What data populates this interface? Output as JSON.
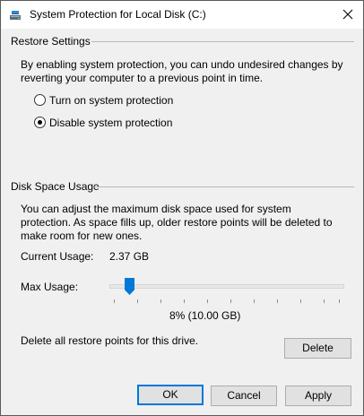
{
  "window": {
    "title": "System Protection for Local Disk (C:)",
    "icons": {
      "app": "system-protection-icon",
      "close": "close-icon"
    }
  },
  "restore_settings": {
    "header": "Restore Settings",
    "description": "By enabling system protection, you can undo undesired changes by reverting your computer to a previous point in time.",
    "options": [
      {
        "label": "Turn on system protection",
        "selected": false
      },
      {
        "label": "Disable system protection",
        "selected": true
      }
    ]
  },
  "disk_space": {
    "header": "Disk Space Usage",
    "description": "You can adjust the maximum disk space used for system protection. As space fills up, older restore points will be deleted to make room for new ones.",
    "current_usage_label": "Current Usage:",
    "current_usage_value": "2.37 GB",
    "max_usage_label": "Max Usage:",
    "max_usage_percent": 8,
    "max_usage_display": "8% (10.00 GB)",
    "delete_text": "Delete all restore points for this drive.",
    "delete_button": "Delete"
  },
  "buttons": {
    "ok": "OK",
    "cancel": "Cancel",
    "apply": "Apply"
  },
  "colors": {
    "accent": "#0078d7",
    "window_bg": "#f0f0f0",
    "titlebar_bg": "#ffffff"
  }
}
